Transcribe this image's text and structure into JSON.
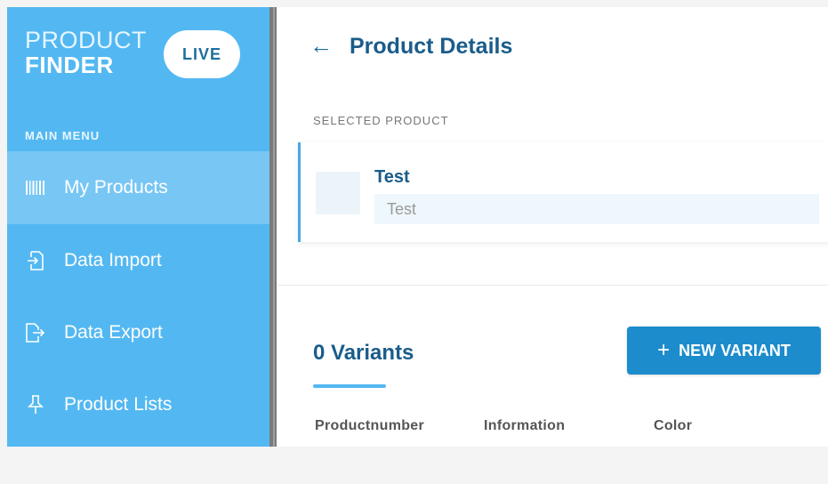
{
  "brand": {
    "line1": "PRODUCT",
    "line2": "FINDER",
    "badge": "LIVE"
  },
  "sidebar": {
    "heading": "MAIN MENU",
    "items": [
      {
        "label": "My Products",
        "icon": "barcode-icon",
        "active": true
      },
      {
        "label": "Data Import",
        "icon": "file-import-icon",
        "active": false
      },
      {
        "label": "Data Export",
        "icon": "file-export-icon",
        "active": false
      },
      {
        "label": "Product Lists",
        "icon": "pin-icon",
        "active": false
      }
    ]
  },
  "header": {
    "back_icon": "←",
    "title": "Product Details"
  },
  "selected_product": {
    "label": "SELECTED PRODUCT",
    "name": "Test",
    "subtitle": "Test"
  },
  "variants": {
    "title": "0 Variants",
    "new_button_icon": "+",
    "new_button_label": "NEW VARIANT",
    "columns": [
      "Productnumber",
      "Information",
      "Color"
    ]
  },
  "colors": {
    "sidebar": "#53b8f2",
    "sidebar_active": "#77c6f4",
    "primary": "#1c8ccc",
    "title": "#1a5c8a"
  }
}
